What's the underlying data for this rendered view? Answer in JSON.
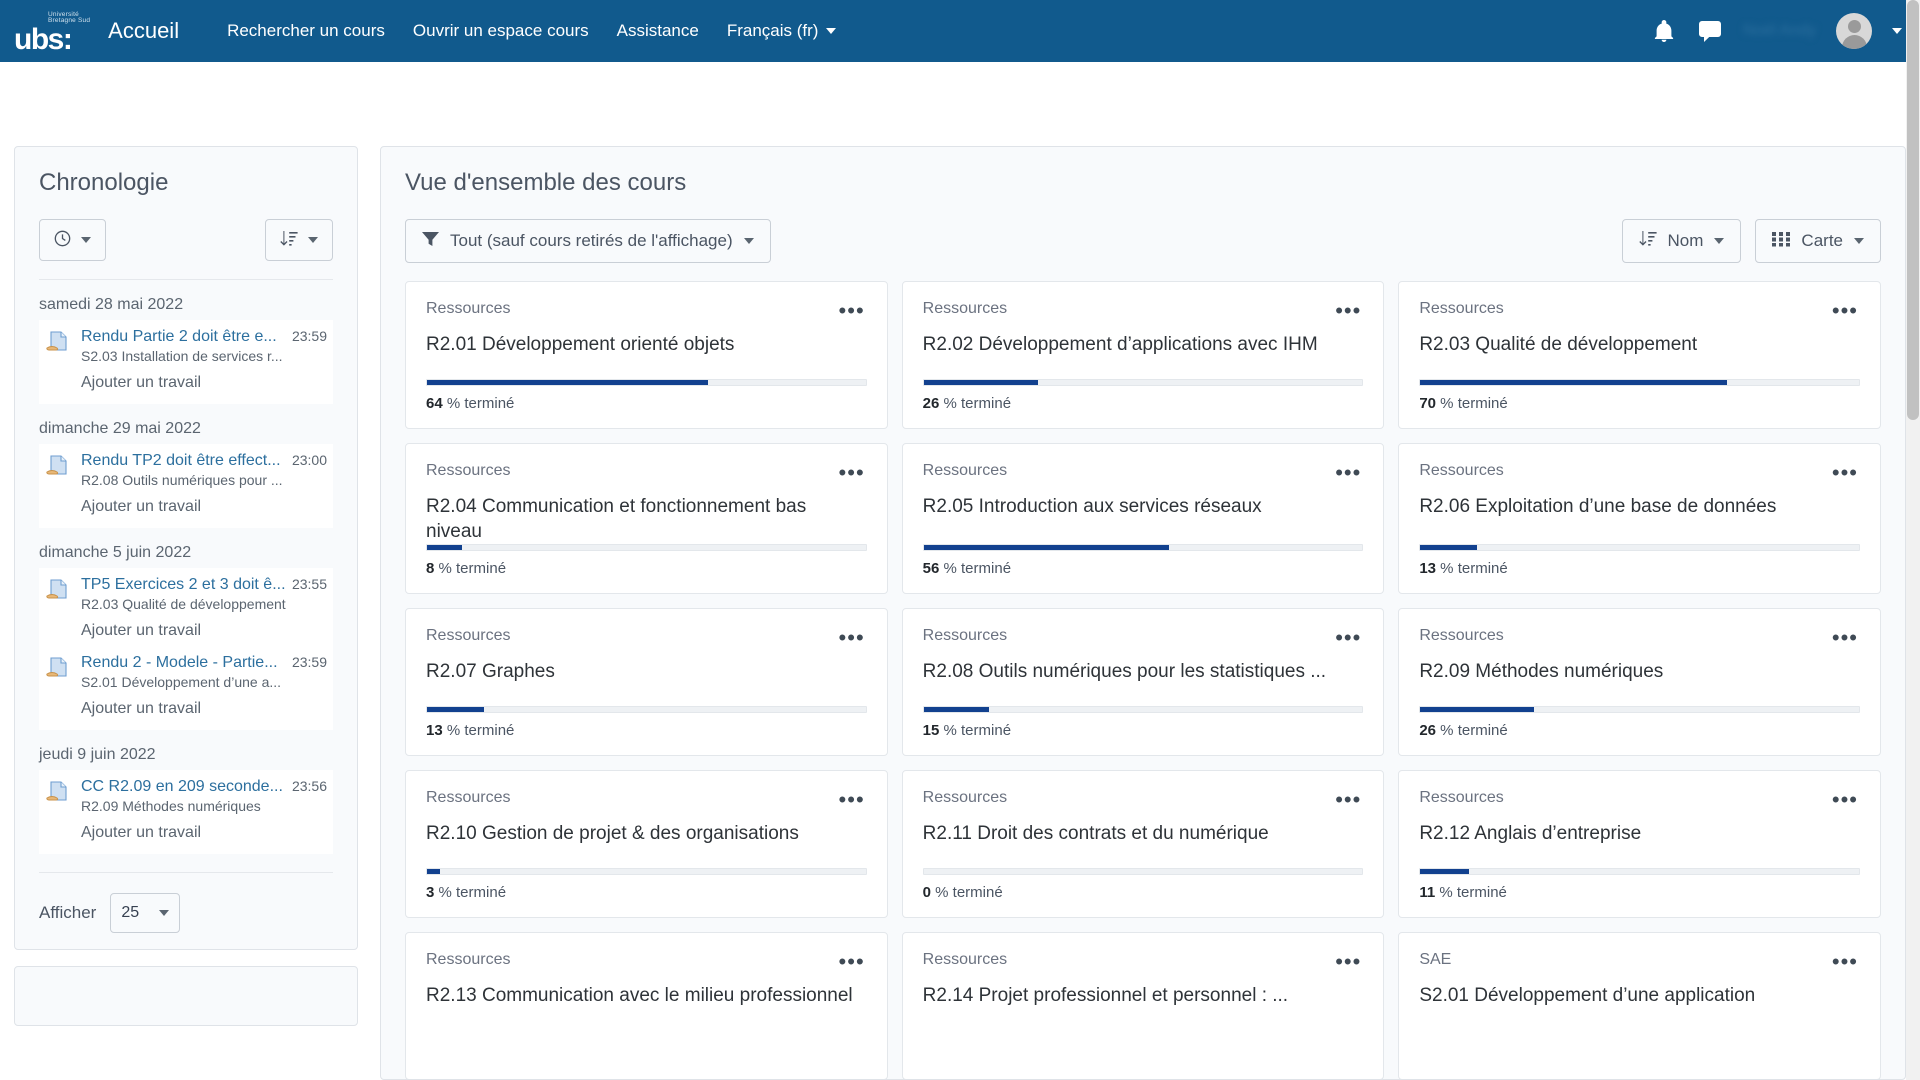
{
  "navbar": {
    "logo_sup_line1": "Université",
    "logo_sup_line2": "Bretagne Sud",
    "logo_text": "ubs",
    "logo_colon": ":",
    "home_label": "Accueil",
    "links": [
      {
        "label": "Rechercher un cours"
      },
      {
        "label": "Ouvrir un espace cours"
      },
      {
        "label": "Assistance"
      }
    ],
    "language": "Français (fr)",
    "notifications_icon": "bell-icon",
    "messages_icon": "chat-icon",
    "username": "Noël Andy",
    "brand_color": "#115a8d"
  },
  "sidebar": {
    "title": "Chronologie",
    "date_filter_icon": "clock-icon",
    "sort_icon": "sort-amount-down-icon",
    "groups": [
      {
        "date": "samedi 28 mai 2022",
        "items": [
          {
            "icon": "assignment-icon",
            "name": "Rendu Partie 2 doit être e...",
            "time": "23:59",
            "course": "S2.03 Installation de services r...",
            "action": "Ajouter un travail"
          }
        ]
      },
      {
        "date": "dimanche 29 mai 2022",
        "items": [
          {
            "icon": "assignment-icon",
            "name": "Rendu TP2 doit être effect...",
            "time": "23:00",
            "course": "R2.08 Outils numériques pour ...",
            "action": "Ajouter un travail"
          }
        ]
      },
      {
        "date": "dimanche 5 juin 2022",
        "items": [
          {
            "icon": "assignment-icon",
            "name": "TP5 Exercices 2 et 3 doit ê...",
            "time": "23:55",
            "course": "R2.03 Qualité de développement",
            "action": "Ajouter un travail"
          },
          {
            "icon": "assignment-icon",
            "name": "Rendu 2 - Modele - Partie...",
            "time": "23:59",
            "course": "S2.01 Développement d’une a...",
            "action": "Ajouter un travail"
          }
        ]
      },
      {
        "date": "jeudi 9 juin 2022",
        "items": [
          {
            "icon": "assignment-icon",
            "name": "CC R2.09 en 209 seconde...",
            "time": "23:56",
            "course": "R2.09 Méthodes numériques",
            "action": "Ajouter un travail"
          }
        ]
      }
    ],
    "show_label": "Afficher",
    "show_value": "25"
  },
  "main": {
    "title": "Vue d'ensemble des cours",
    "filter": {
      "icon": "filter-icon",
      "label": "Tout (sauf cours retirés de l'affichage)"
    },
    "sort": {
      "icon": "sort-amount-down-icon",
      "label": "Nom"
    },
    "view": {
      "icon": "grid-icon",
      "label": "Carte"
    },
    "progress_color": "#12418f",
    "percent_suffix": "% terminé",
    "menu_glyph": "•••",
    "courses": [
      {
        "category": "Ressources",
        "name": "R2.01 Développement orienté objets",
        "percent": 64
      },
      {
        "category": "Ressources",
        "name": "R2.02 Développement d’applications avec IHM",
        "percent": 26
      },
      {
        "category": "Ressources",
        "name": "R2.03 Qualité de développement",
        "percent": 70
      },
      {
        "category": "Ressources",
        "name": "R2.04 Communication et fonctionnement bas niveau",
        "percent": 8
      },
      {
        "category": "Ressources",
        "name": "R2.05 Introduction aux services réseaux",
        "percent": 56
      },
      {
        "category": "Ressources",
        "name": "R2.06 Exploitation d’une base de données",
        "percent": 13
      },
      {
        "category": "Ressources",
        "name": "R2.07 Graphes",
        "percent": 13
      },
      {
        "category": "Ressources",
        "name": "R2.08 Outils numériques pour les statistiques ...",
        "percent": 15
      },
      {
        "category": "Ressources",
        "name": "R2.09 Méthodes numériques",
        "percent": 26
      },
      {
        "category": "Ressources",
        "name": "R2.10 Gestion de projet & des organisations",
        "percent": 3
      },
      {
        "category": "Ressources",
        "name": "R2.11 Droit des contrats et du numérique",
        "percent": 0
      },
      {
        "category": "Ressources",
        "name": "R2.12 Anglais d’entreprise",
        "percent": 11
      },
      {
        "category": "Ressources",
        "name": "R2.13 Communication avec le milieu professionnel",
        "percent": null
      },
      {
        "category": "Ressources",
        "name": "R2.14 Projet professionnel et personnel : ...",
        "percent": null
      },
      {
        "category": "SAE",
        "name": "S2.01 Développement d’une application",
        "percent": null
      }
    ]
  }
}
